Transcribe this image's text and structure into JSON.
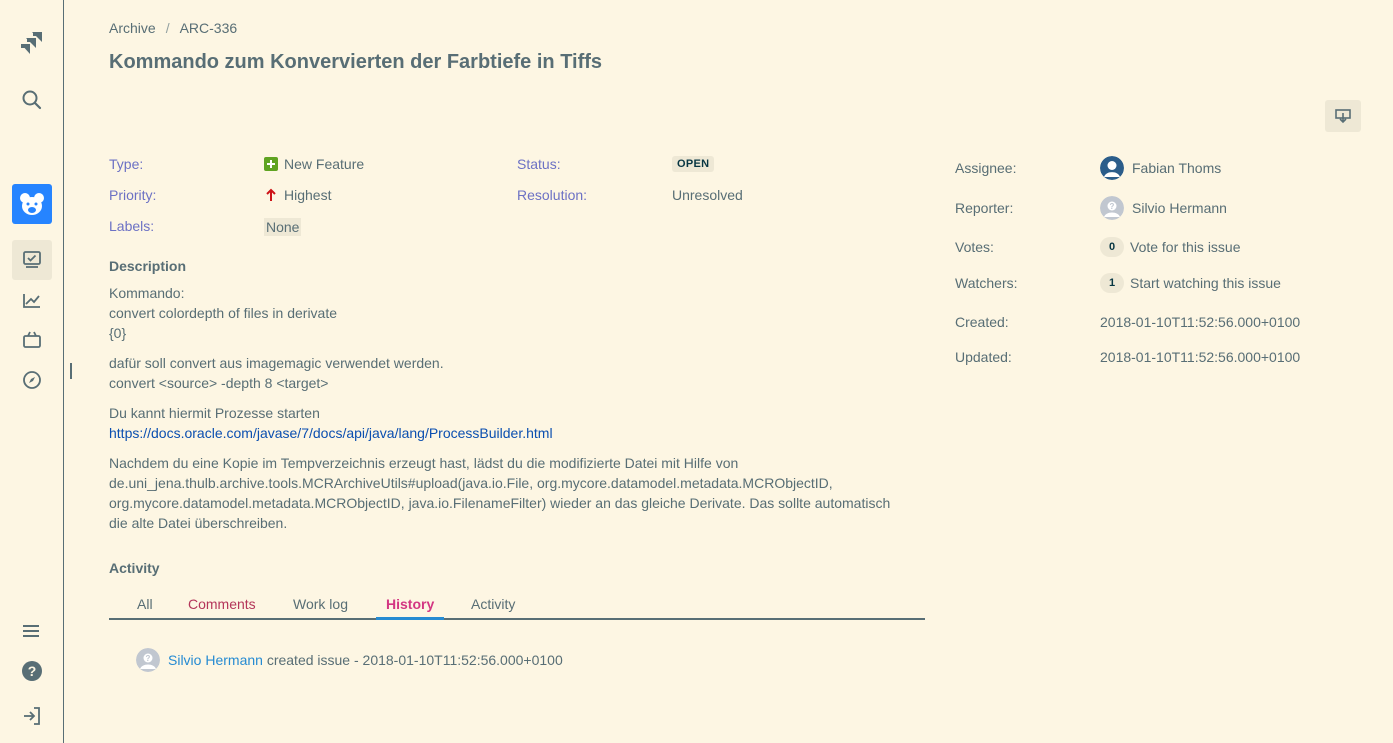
{
  "breadcrumb": {
    "project": "Archive",
    "separator": "/",
    "issue_key": "ARC-336"
  },
  "issue": {
    "title": "Kommando zum Konvervierten der Farbtiefe in Tiffs"
  },
  "details": {
    "type_label": "Type:",
    "type_value": "New Feature",
    "priority_label": "Priority:",
    "priority_value": "Highest",
    "labels_label": "Labels:",
    "labels_value": "None",
    "status_label": "Status:",
    "status_value": "OPEN",
    "resolution_label": "Resolution:",
    "resolution_value": "Unresolved"
  },
  "description": {
    "heading": "Description",
    "p1": [
      "Kommando:",
      "convert colordepth of files in derivate",
      "{0}"
    ],
    "p2": [
      "dafür soll convert aus imagemagic verwendet werden.",
      "convert <source> -depth 8 <target>"
    ],
    "p3_text": "Du kannt hiermit Prozesse starten",
    "p3_link": "https://docs.oracle.com/javase/7/docs/api/java/lang/ProcessBuilder.html",
    "p4": [
      "Nachdem du eine Kopie im Tempverzeichnis erzeugt hast, lädst du die modifizierte Datei mit Hilfe von",
      "de.uni_jena.thulb.archive.tools.MCRArchiveUtils#upload(java.io.File, org.mycore.datamodel.metadata.MCRObjectID,",
      "org.mycore.datamodel.metadata.MCRObjectID, java.io.FilenameFilter) wieder an das gleiche Derivate. Das sollte automatisch",
      "die alte Datei überschreiben."
    ]
  },
  "activity": {
    "heading": "Activity",
    "tabs": [
      "All",
      "Comments",
      "Work log",
      "History",
      "Activity"
    ],
    "active_tab": "History",
    "entry_user": "Silvio Hermann",
    "entry_text": " created issue - 2018-01-10T11:52:56.000+0100"
  },
  "people": {
    "assignee_label": "Assignee:",
    "assignee": "Fabian Thoms",
    "reporter_label": "Reporter:",
    "reporter": "Silvio Hermann",
    "votes_label": "Votes:",
    "votes_count": "0",
    "votes_action": "Vote for this issue",
    "watchers_label": "Watchers:",
    "watchers_count": "1",
    "watchers_action": "Start watching this issue"
  },
  "dates": {
    "created_label": "Created:",
    "created": "2018-01-10T11:52:56.000+0100",
    "updated_label": "Updated:",
    "updated": "2018-01-10T11:52:56.000+0100"
  },
  "colors": {
    "background": "#fdf6e3",
    "link": "#268bd2",
    "label": "#6c71c4",
    "active_tab": "#d33682",
    "tab_underline": "#268bd2"
  },
  "icons": {
    "sidebar": [
      "jira-logo-icon",
      "search-icon",
      "project-avatar-icon",
      "board-icon",
      "reports-icon",
      "releases-icon",
      "compass-icon",
      "menu-icon",
      "help-icon",
      "logout-icon"
    ],
    "export": "export-icon"
  }
}
